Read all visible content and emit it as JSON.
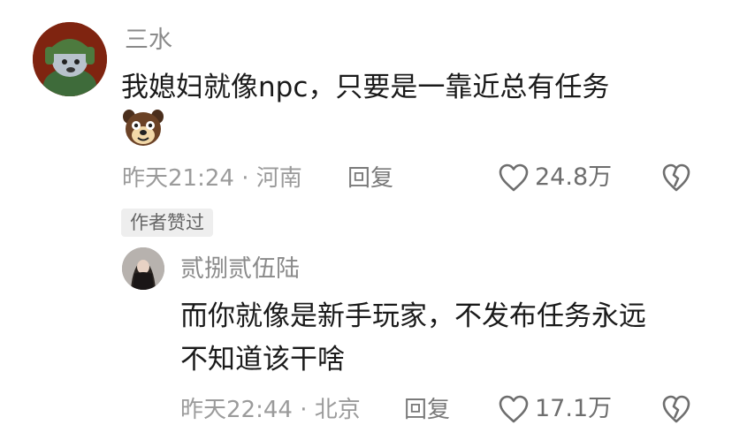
{
  "comment": {
    "username": "三水",
    "text": "我媳妇就像npc，只要是一靠近总有任务",
    "sticker_icon": "dog-face-sticker-icon",
    "meta": "昨天21:24 · 河南",
    "reply_label": "回复",
    "like_count": "24.8万",
    "author_badge": "作者赞过"
  },
  "reply": {
    "username": "贰捌贰伍陆",
    "text_line1": "而你就像是新手玩家，不发布任务永远",
    "text_line2": "不知道该干啥",
    "meta": "昨天22:44 · 北京",
    "reply_label": "回复",
    "like_count": "17.1万"
  },
  "colors": {
    "meta_gray": "#9b9b9b",
    "text_dark": "#1a1a1a",
    "badge_bg": "#eeeeee"
  }
}
